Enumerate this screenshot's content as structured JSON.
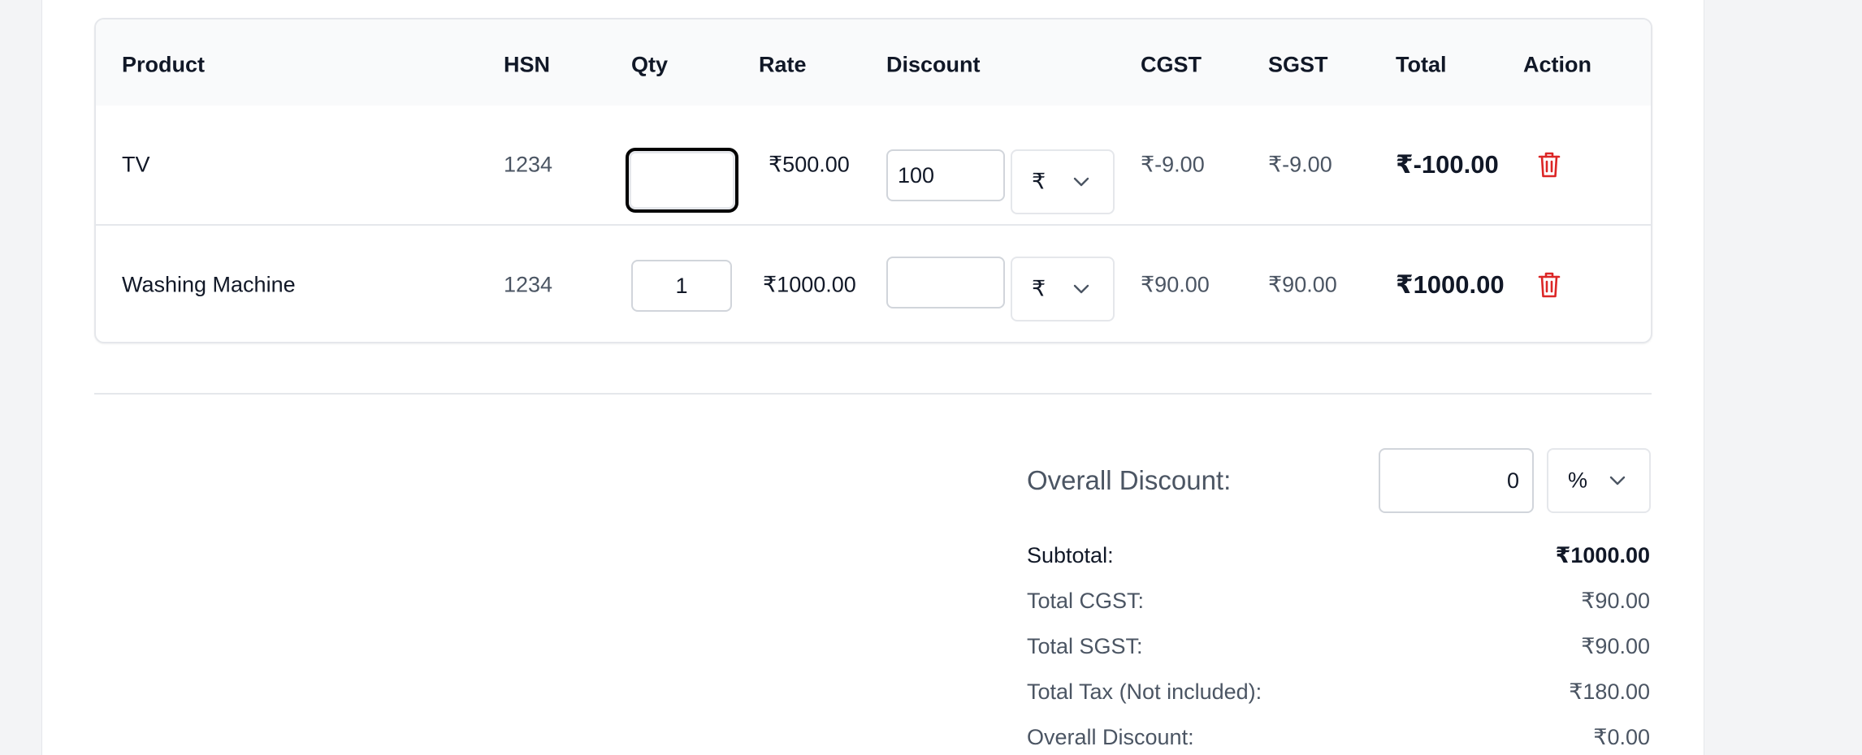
{
  "table": {
    "headers": {
      "product": "Product",
      "hsn": "HSN",
      "qty": "Qty",
      "rate": "Rate",
      "discount": "Discount",
      "cgst": "CGST",
      "sgst": "SGST",
      "total": "Total",
      "action": "Action"
    },
    "rows": [
      {
        "product": "TV",
        "hsn": "1234",
        "qty": "",
        "rate": "₹500.00",
        "discount": "100",
        "discount_type": "₹",
        "cgst": "₹-9.00",
        "sgst": "₹-9.00",
        "total": "₹-100.00"
      },
      {
        "product": "Washing Machine",
        "hsn": "1234",
        "qty": "1",
        "rate": "₹1000.00",
        "discount": "",
        "discount_type": "₹",
        "cgst": "₹90.00",
        "sgst": "₹90.00",
        "total": "₹1000.00"
      }
    ]
  },
  "summary": {
    "overall_discount_label": "Overall Discount:",
    "overall_discount_value": "0",
    "overall_discount_type": "%",
    "lines": [
      {
        "label": "Subtotal:",
        "value": "₹1000.00"
      },
      {
        "label": "Total CGST:",
        "value": "₹90.00"
      },
      {
        "label": "Total SGST:",
        "value": "₹90.00"
      },
      {
        "label": "Total Tax (Not included):",
        "value": "₹180.00"
      },
      {
        "label": "Overall Discount:",
        "value": "₹0.00"
      }
    ]
  },
  "colors": {
    "delete_icon": "#dc2626",
    "muted_text": "#4b5563",
    "border": "#e5e7eb",
    "focus_ring": "#000000"
  },
  "icons": {
    "delete": "trash-icon",
    "select": "chevron-down-icon"
  }
}
